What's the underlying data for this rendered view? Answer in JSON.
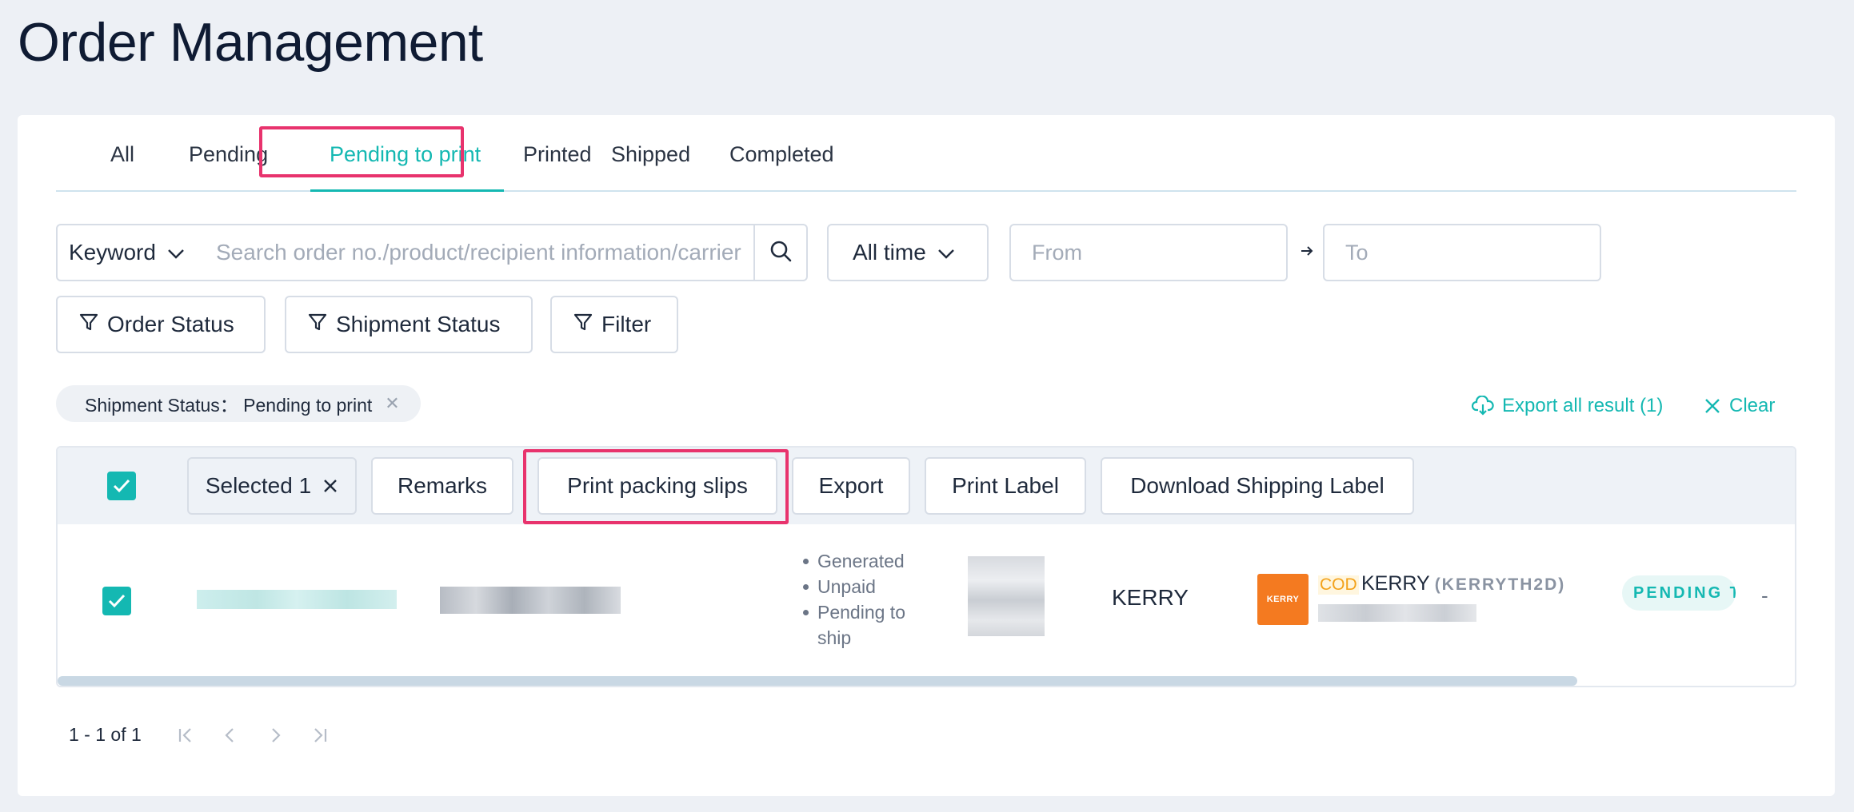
{
  "page": {
    "title": "Order Management"
  },
  "tabs": [
    {
      "label": "All"
    },
    {
      "label": "Pending"
    },
    {
      "label": "Pending to print",
      "active": true
    },
    {
      "label": "Printed"
    },
    {
      "label": "Shipped"
    },
    {
      "label": "Completed"
    }
  ],
  "search": {
    "keyword_label": "Keyword",
    "placeholder": "Search order no./product/recipient information/carrier",
    "time_label": "All time",
    "from_placeholder": "From",
    "to_placeholder": "To"
  },
  "filters": {
    "order_status": "Order Status",
    "shipment_status": "Shipment Status",
    "filter": "Filter"
  },
  "active_chip": {
    "label": "Shipment Status： Pending to print"
  },
  "actions": {
    "export_all": "Export all result (1)",
    "clear": "Clear"
  },
  "toolbar": {
    "selected": "Selected 1",
    "remarks": "Remarks",
    "print_packing_slips": "Print packing slips",
    "export": "Export",
    "print_label": "Print Label",
    "download_shipping_label": "Download Shipping Label"
  },
  "row": {
    "statuses": [
      "Generated",
      "Unpaid",
      "Pending to ship"
    ],
    "carrier": "KERRY",
    "logo_text": "KERRY",
    "cod": "COD",
    "shipping_carrier": "KERRY",
    "shipping_code": "(KERRYTH2D)",
    "badge": "PENDING TO PRINT",
    "dash": "-"
  },
  "pagination": {
    "summary": "1 - 1 of 1"
  },
  "colors": {
    "accent": "#14b8b2",
    "highlight": "#e8336d",
    "kerry": "#f47a20"
  }
}
